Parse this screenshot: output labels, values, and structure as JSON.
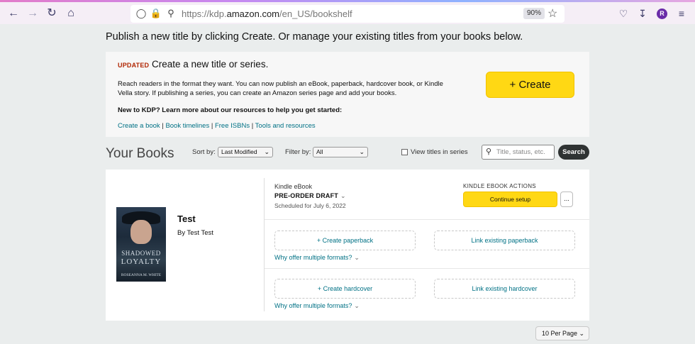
{
  "browser": {
    "url_prefix": "https://kdp.",
    "url_domain": "amazon.com",
    "url_path": "/en_US/bookshelf",
    "zoom": "90%",
    "avatar_letter": "R",
    "icons": {
      "back": "arrow-left-icon",
      "forward": "arrow-right-icon",
      "reload": "reload-icon",
      "home": "home-icon",
      "shield": "shield-icon",
      "lock": "lock-icon",
      "key": "key-icon",
      "star": "star-icon",
      "pocket": "pocket-icon",
      "download": "download-icon",
      "menu": "hamburger-menu-icon"
    }
  },
  "intro": "Publish a new title by clicking Create. Or manage your existing titles from your books below.",
  "create_panel": {
    "badge": "UPDATED",
    "title": "Create a new title or series.",
    "description": "Reach readers in the format they want. You can now publish an eBook, paperback, hardcover book, or Kindle Vella story. If publishing a series, you can create an Amazon series page and add your books.",
    "new_to_kdp": "New to KDP? Learn more about our resources to help you get started:",
    "links": [
      "Create a book",
      "Book timelines",
      "Free ISBNs",
      "Tools and resources"
    ],
    "create_button": "+ Create"
  },
  "books": {
    "heading": "Your Books",
    "sort_label": "Sort by:",
    "sort_value": "Last Modified",
    "filter_label": "Filter by:",
    "filter_value": "All",
    "series_checkbox_label": "View titles in series",
    "search_placeholder": "Title, status, etc.",
    "search_button": "Search"
  },
  "book": {
    "title": "Test",
    "author": "By Test Test",
    "cover_text": {
      "title_line1": "SHADOWED",
      "title_line2": "LOYALTY",
      "author": "ROSEANNA M. WHITE"
    },
    "format": "Kindle eBook",
    "status": "PRE-ORDER DRAFT",
    "scheduled": "Scheduled for July 6, 2022",
    "actions_title": "KINDLE EBOOK ACTIONS",
    "continue_button": "Continue setup",
    "more_button": "...",
    "create_paperback": "+ Create paperback",
    "link_paperback": "Link existing paperback",
    "why_multiple_1": "Why offer multiple formats?",
    "create_hardcover": "+ Create hardcover",
    "link_hardcover": "Link existing hardcover",
    "why_multiple_2": "Why offer multiple formats?"
  },
  "pagination": {
    "per_page": "10 Per Page"
  },
  "colors": {
    "accent_yellow": "#ffd814",
    "link_teal": "#007185",
    "updated_red": "#b12704"
  }
}
